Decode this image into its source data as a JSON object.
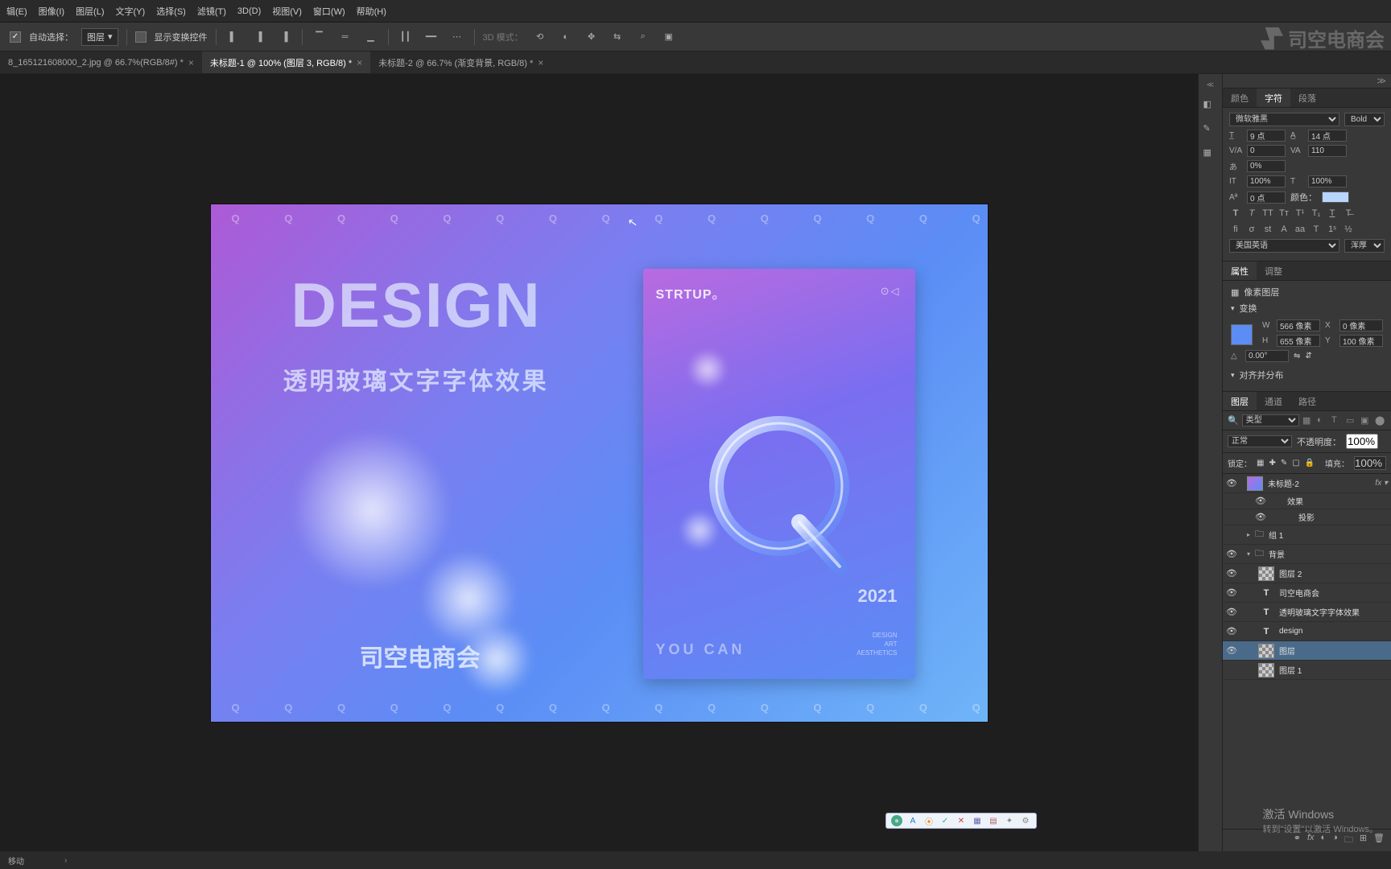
{
  "menubar": [
    "辑(E)",
    "图像(I)",
    "图层(L)",
    "文字(Y)",
    "选择(S)",
    "滤镜(T)",
    "3D(D)",
    "视图(V)",
    "窗口(W)",
    "帮助(H)"
  ],
  "options": {
    "auto_select": "自动选择：",
    "target": "图层",
    "show_transform": "显示变换控件",
    "mode3d": "3D 模式："
  },
  "tabs": [
    {
      "label": "8_165121608000_2.jpg @ 66.7%(RGB/8#) *",
      "active": false
    },
    {
      "label": "未标题-1 @ 100% (图层 3, RGB/8) *",
      "active": true
    },
    {
      "label": "未标题-2 @ 66.7% (渐变背景, RGB/8) *",
      "active": false
    }
  ],
  "canvas": {
    "q_line": "Q Q Q Q Q Q Q Q Q Q Q Q Q Q Q Q Q Q Q Q Q Q Q Q Q",
    "design": "DESIGN",
    "subtitle": "透明玻璃文字字体效果",
    "brand": "司空电商会",
    "strtup": "STRTUP",
    "ci": "⊙◁",
    "year": "2021",
    "youcan": "YOU  CAN",
    "tiny1": "DESIGN",
    "tiny2": "ART",
    "tiny3": "AESTHETICS"
  },
  "char_panel": {
    "tabs": [
      "颜色",
      "字符",
      "段落"
    ],
    "font": "微软雅黑",
    "weight": "Bold",
    "size": "9 点",
    "leading": "14 点",
    "va": "0",
    "tracking": "110",
    "scale": "0%",
    "vscale": "100%",
    "hscale": "100%",
    "baseline": "0 点",
    "color_label": "颜色：",
    "lang": "美国英语",
    "aa": "浑厚"
  },
  "props_panel": {
    "tabs": [
      "属性",
      "调整"
    ],
    "type_label": "像素图层",
    "transform": "变换",
    "w": "566 像素",
    "x": "0 像素",
    "h": "655 像素",
    "y": "100 像素",
    "angle": "0.00°",
    "align": "对齐并分布"
  },
  "layers_panel": {
    "tabs": [
      "图层",
      "通道",
      "路径"
    ],
    "filter": "类型",
    "blend": "正常",
    "opacity_label": "不透明度：",
    "opacity": "100%",
    "lock_label": "锁定：",
    "fill_label": "填充：",
    "fill": "100%",
    "layers": [
      {
        "eye": true,
        "kind": "smart",
        "name": "未标题-2",
        "fx": true,
        "indent": 0
      },
      {
        "eye": true,
        "kind": "sub",
        "name": "效果",
        "indent": 1
      },
      {
        "eye": true,
        "kind": "sub",
        "name": "投影",
        "indent": 2
      },
      {
        "eye": false,
        "kind": "folder",
        "name": "组 1",
        "indent": 0,
        "caret": ">"
      },
      {
        "eye": true,
        "kind": "folder",
        "name": "背景",
        "indent": 0,
        "caret": "v"
      },
      {
        "eye": true,
        "kind": "checker",
        "name": "图层 2",
        "indent": 1
      },
      {
        "eye": true,
        "kind": "text",
        "name": "司空电商会",
        "indent": 1
      },
      {
        "eye": true,
        "kind": "text",
        "name": "透明玻璃文字字体效果",
        "indent": 1
      },
      {
        "eye": true,
        "kind": "text",
        "name": "design",
        "indent": 1
      },
      {
        "eye": true,
        "kind": "checker",
        "name": "图层",
        "indent": 1,
        "selected": true
      },
      {
        "eye": false,
        "kind": "checker",
        "name": "图层 1",
        "indent": 1
      }
    ]
  },
  "status": {
    "tool": "移动"
  },
  "watermark": {
    "line1": "激活 Windows",
    "line2": "转到\"设置\"以激活 Windows。",
    "brand": "司空电商会"
  }
}
